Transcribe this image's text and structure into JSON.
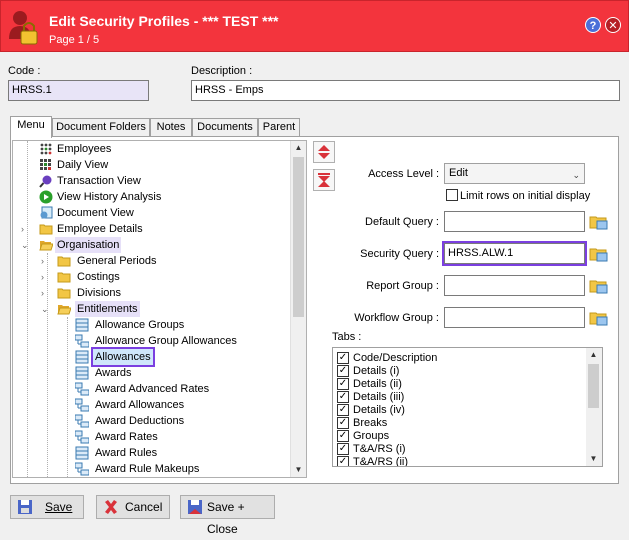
{
  "window": {
    "title": "Edit Security Profiles - *** TEST ***",
    "subtitle": "Page 1 / 5",
    "help_label": "?",
    "close_label": "✕"
  },
  "form": {
    "code_label": "Code :",
    "code_value": "HRSS.1",
    "description_label": "Description :",
    "description_value": "HRSS - Emps"
  },
  "tabs": [
    "Menu",
    "Document Folders",
    "Notes",
    "Documents",
    "Parent"
  ],
  "tree": [
    {
      "label": "Employees",
      "icon": "employees-icon"
    },
    {
      "label": "Daily View",
      "icon": "calendar-icon"
    },
    {
      "label": "Transaction View",
      "icon": "search-icon"
    },
    {
      "label": "View History Analysis",
      "icon": "play-icon"
    },
    {
      "label": "Document View",
      "icon": "document-icon"
    },
    {
      "label": "Employee Details",
      "icon": "folder-icon"
    },
    {
      "label": "Organisation",
      "icon": "folder-open-icon"
    },
    {
      "label": "General Periods",
      "icon": "folder-icon"
    },
    {
      "label": "Costings",
      "icon": "folder-icon"
    },
    {
      "label": "Divisions",
      "icon": "folder-icon"
    },
    {
      "label": "Entitlements",
      "icon": "folder-open-icon"
    },
    {
      "label": "Allowance Groups",
      "icon": "list-icon"
    },
    {
      "label": "Allowance Group Allowances",
      "icon": "relation-icon"
    },
    {
      "label": "Allowances",
      "icon": "list-icon"
    },
    {
      "label": "Awards",
      "icon": "list-icon"
    },
    {
      "label": "Award Advanced Rates",
      "icon": "relation-icon"
    },
    {
      "label": "Award Allowances",
      "icon": "relation-icon"
    },
    {
      "label": "Award Deductions",
      "icon": "relation-icon"
    },
    {
      "label": "Award Rates",
      "icon": "relation-icon"
    },
    {
      "label": "Award Rules",
      "icon": "list-icon"
    },
    {
      "label": "Award Rule Makeups",
      "icon": "relation-icon"
    }
  ],
  "settings": {
    "access_level_label": "Access Level :",
    "access_level_value": "Edit",
    "limit_rows_label": "Limit rows on initial display",
    "default_query_label": "Default Query :",
    "default_query_value": "",
    "security_query_label": "Security Query :",
    "security_query_value": "HRSS.ALW.1",
    "report_group_label": "Report Group :",
    "report_group_value": "",
    "workflow_group_label": "Workflow Group :",
    "workflow_group_value": "",
    "tabs_label": "Tabs :"
  },
  "tab_items": [
    {
      "label": "Code/Description",
      "checked": true
    },
    {
      "label": "Details (i)",
      "checked": true
    },
    {
      "label": "Details (ii)",
      "checked": true
    },
    {
      "label": "Details (iii)",
      "checked": true
    },
    {
      "label": "Details (iv)",
      "checked": true
    },
    {
      "label": "Breaks",
      "checked": true
    },
    {
      "label": "Groups",
      "checked": true
    },
    {
      "label": "T&A/RS (i)",
      "checked": true
    },
    {
      "label": "T&A/RS (ii)",
      "checked": true
    }
  ],
  "buttons": {
    "save": "Save",
    "cancel": "Cancel",
    "save_close": "Save + Close"
  },
  "colors": {
    "titlebar": "#f3343d",
    "highlight": "#7b3fe0"
  }
}
